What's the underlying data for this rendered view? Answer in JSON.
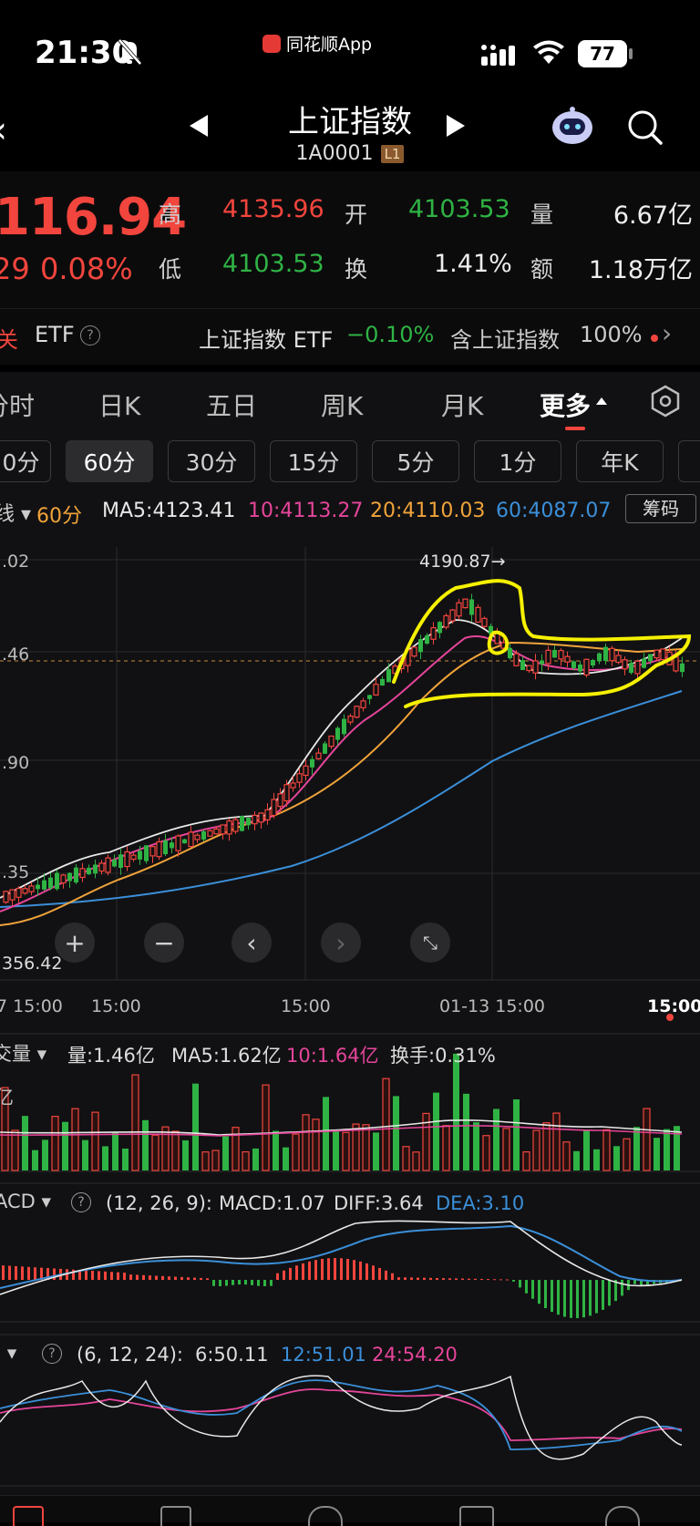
{
  "status": {
    "time": "21:30",
    "app_badge": "同花顺App",
    "battery": "77"
  },
  "header": {
    "title": "上证指数",
    "code": "1A0001",
    "level": "L1"
  },
  "quote": {
    "price": "116.94",
    "change": "29",
    "change_pct": "0.08%",
    "high_label": "高",
    "high": "4135.96",
    "open_label": "开",
    "open": "4103.53",
    "volume_label": "量",
    "volume": "6.67亿",
    "low_label": "低",
    "low": "4103.53",
    "turnover_label": "换",
    "turnover": "1.41%",
    "amount_label": "额",
    "amount": "1.18万亿"
  },
  "etf": {
    "prefix": "关",
    "label": "ETF",
    "name": "上证指数 ETF",
    "change": "−0.10%",
    "contains": "含上证指数",
    "pct": "100%"
  },
  "tabs": [
    "分时",
    "日K",
    "五日",
    "周K",
    "月K",
    "更多"
  ],
  "period_buttons": [
    "0分",
    "60分",
    "30分",
    "15分",
    "5分",
    "1分",
    "年K"
  ],
  "ma": {
    "period": "60分",
    "ma5": "MA5:4123.41",
    "ma10": "10:4113.27",
    "ma20": "20:4110.03",
    "ma60": "60:4087.07",
    "chip_button": "筹码"
  },
  "price_axis": {
    "top": ".02",
    "mid": ".46",
    "low": ".90",
    "bottom1": ".35",
    "bottom2": "356.42"
  },
  "peak_label": "4190.87→",
  "time_axis": [
    "7 15:00",
    "15:00",
    "15:00",
    "01-13 15:00",
    "15:00"
  ],
  "volume_panel": {
    "label": "交量",
    "vol": "量:1.46亿",
    "ma5": "MA5:1.62亿",
    "ma10": "10:1.64亿",
    "turn": "换手:0.31%",
    "unit": "亿"
  },
  "macd_panel": {
    "label": "ACD",
    "params": "(12, 26, 9):",
    "macd": "MACD:1.07",
    "diff": "DIFF:3.64",
    "dea": "DEA:3.10"
  },
  "rsi_panel": {
    "params": "(6, 12, 24):",
    "r6": "6:50.11",
    "r12": "12:51.01",
    "r24": "24:54.20"
  },
  "colors": {
    "up": "#f2453d",
    "down": "#2fb344",
    "ma5": "#e8e8e8",
    "ma10": "#e5459a",
    "ma20": "#f0a33a",
    "ma60": "#3b8fd9",
    "highlight": "#f5f000"
  },
  "icons": [
    "muted-bell-icon",
    "signal-icon",
    "wifi-icon",
    "battery-icon",
    "robot-icon",
    "search-icon",
    "settings-hex-icon",
    "help-icon"
  ]
}
